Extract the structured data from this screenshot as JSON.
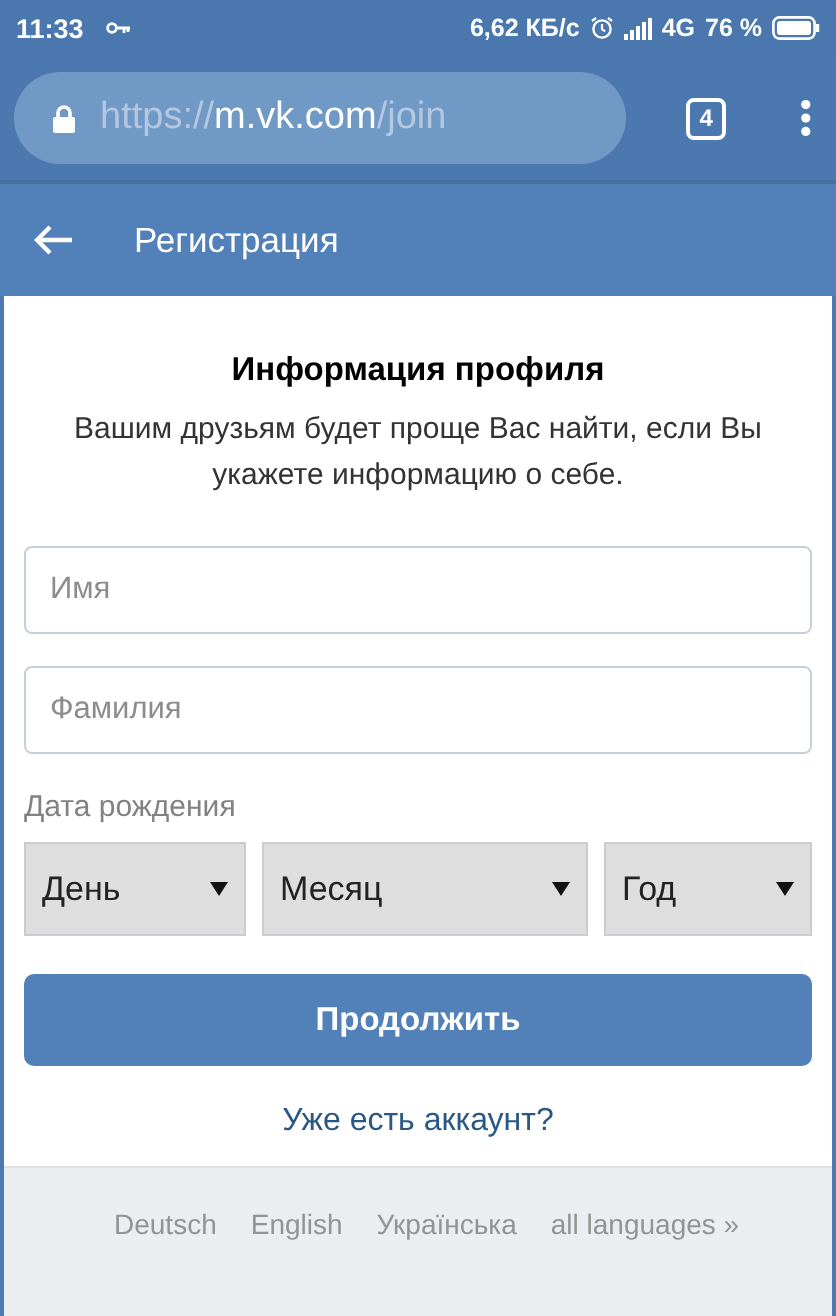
{
  "status_bar": {
    "time": "11:33",
    "speed": "6,62 КБ/с",
    "network": "4G",
    "battery": "76 %"
  },
  "browser": {
    "url_scheme": "https://",
    "url_host": "m.vk.com",
    "url_path": "/join",
    "tab_count": "4"
  },
  "header": {
    "title": "Регистрация"
  },
  "form": {
    "title": "Информация профиля",
    "subtitle": "Вашим друзьям будет проще Вас найти, если Вы укажете информацию о себе.",
    "fields": [
      {
        "placeholder": "Имя"
      },
      {
        "placeholder": "Фамилия"
      }
    ],
    "birth_label": "Дата рождения",
    "selects": [
      {
        "label": "День"
      },
      {
        "label": "Месяц"
      },
      {
        "label": "Год"
      }
    ],
    "submit": "Продолжить",
    "login_link": "Уже есть аккаунт?"
  },
  "languages": [
    "Deutsch",
    "English",
    "Українська",
    "all languages »"
  ]
}
